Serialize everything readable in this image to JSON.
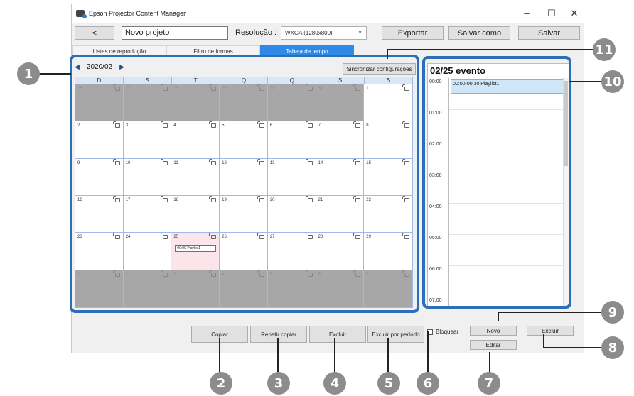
{
  "window": {
    "title": "Epson Projector Content Manager",
    "minimize": "–",
    "maximize": "☐",
    "close": "✕"
  },
  "toolbar": {
    "back": "<",
    "project_name": "Novo projeto",
    "resolution_label": "Resolução :",
    "resolution_value": "WXGA (1280x800)",
    "export": "Exportar",
    "save_as": "Salvar como",
    "save": "Salvar"
  },
  "tabs": [
    "Listas de reprodução",
    "Filtro de formas",
    "Tabela de tempo"
  ],
  "calendar": {
    "month": "2020/02",
    "sync_button": "Sincronizar configurações",
    "day_names": [
      "D",
      "S",
      "T",
      "Q",
      "Q",
      "S",
      "S"
    ],
    "weeks": [
      [
        "26",
        "27",
        "28",
        "29",
        "30",
        "31",
        "1"
      ],
      [
        "2",
        "3",
        "4",
        "5",
        "6",
        "7",
        "8"
      ],
      [
        "9",
        "10",
        "11",
        "12",
        "13",
        "14",
        "15"
      ],
      [
        "16",
        "17",
        "18",
        "19",
        "20",
        "21",
        "22"
      ],
      [
        "23",
        "24",
        "25",
        "26",
        "27",
        "28",
        "29"
      ],
      [
        "1",
        "2",
        "3",
        "4",
        "5",
        "6",
        "7"
      ]
    ],
    "event_chip": "00:00 Playlist1"
  },
  "event_panel": {
    "title": "02/25 evento",
    "times": [
      "00:00",
      "01:00",
      "02:00",
      "03:00",
      "04:00",
      "05:00",
      "06:00",
      "07:00"
    ],
    "event": "00:00-00:30 Playlist1"
  },
  "buttons": {
    "copy": "Copiar",
    "repeat_copy": "Repetir copiar",
    "delete": "Excluir",
    "delete_period": "Excluir por período",
    "lock": "Bloquear",
    "new": "Novo",
    "delete_event": "Excluir",
    "edit": "Editar"
  },
  "callouts": [
    "1",
    "2",
    "3",
    "4",
    "5",
    "6",
    "7",
    "8",
    "9",
    "10",
    "11"
  ]
}
